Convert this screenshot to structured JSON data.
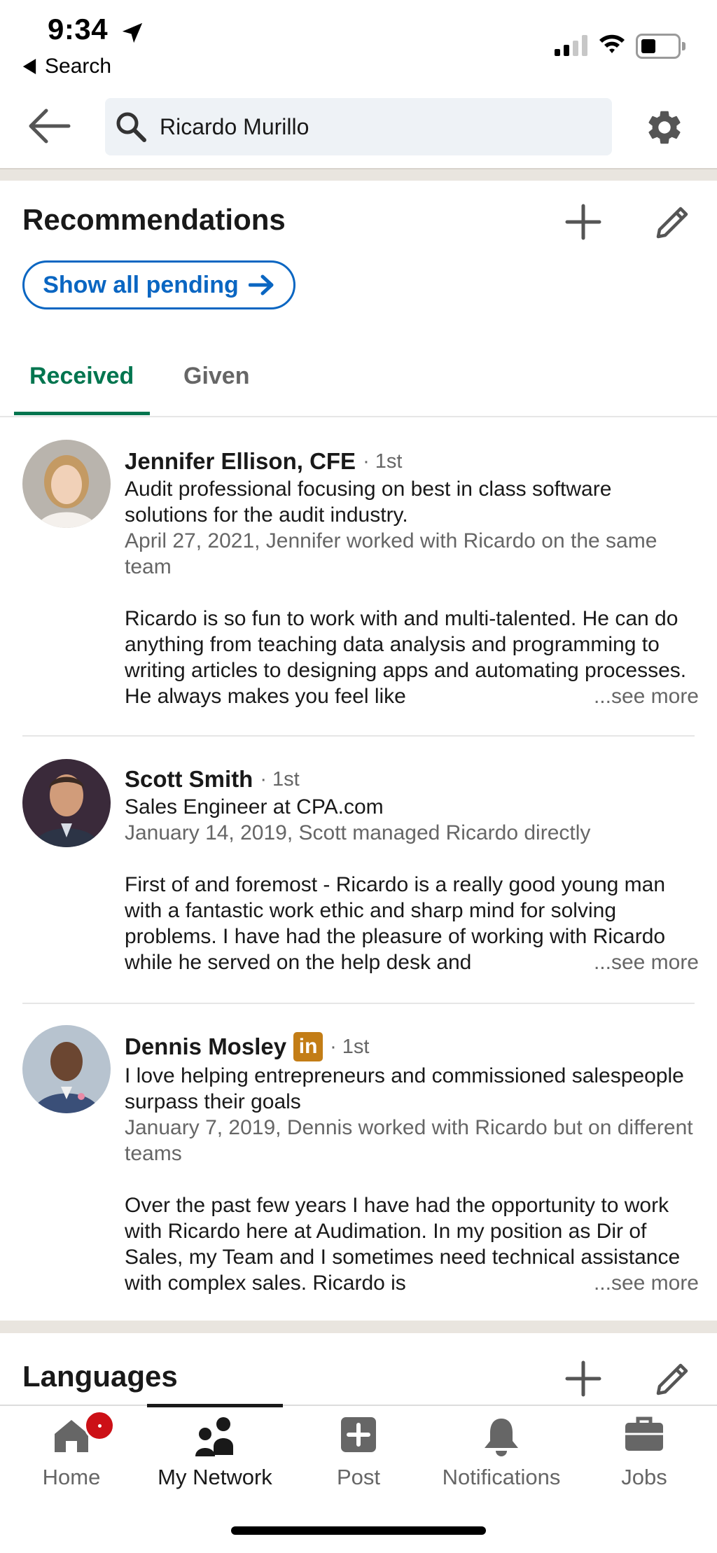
{
  "status_bar": {
    "time": "9:34",
    "back_app": "Search"
  },
  "search": {
    "value": "Ricardo Murillo",
    "placeholder": ""
  },
  "recommendations": {
    "title": "Recommendations",
    "pending_button": "Show all pending",
    "tabs": [
      {
        "label": "Received",
        "active": true
      },
      {
        "label": "Given",
        "active": false
      }
    ],
    "items": [
      {
        "name": "Jennifer Ellison, CFE",
        "degree": "· 1st",
        "headline": "Audit professional focusing on best in class software solutions for the audit industry.",
        "meta": "April 27, 2021, Jennifer worked with Ricardo on the same team",
        "body": "Ricardo is so fun to work with and multi-talented.   He can do anything from teaching data analysis and programming to writing articles to designing apps and automating processes.    He always makes you feel like",
        "see_more": "...see more"
      },
      {
        "name": "Scott Smith",
        "degree": "· 1st",
        "headline": "Sales Engineer at CPA.com",
        "meta": "January 14, 2019, Scott managed Ricardo directly",
        "body": "First of and foremost - Ricardo is a really good young man with a fantastic work ethic and sharp mind for solving problems.  I have had the pleasure of working with Ricardo while he served on the help desk and",
        "see_more": "...see more"
      },
      {
        "name": "Dennis Mosley",
        "badge": "in",
        "degree": "· 1st",
        "headline": "I love helping entrepreneurs and commissioned salespeople surpass their goals",
        "meta": "January 7, 2019, Dennis worked with Ricardo but on different teams",
        "body": "Over the past few years I have had the opportunity to work with Ricardo here at Audimation.  In my position as Dir of Sales, my Team and I sometimes need technical assistance with complex sales.  Ricardo is",
        "see_more": "...see more"
      }
    ]
  },
  "languages": {
    "title": "Languages"
  },
  "bottom_nav": [
    {
      "label": "Home",
      "icon": "home-icon",
      "active": false,
      "badge": "dot"
    },
    {
      "label": "My Network",
      "icon": "people-icon",
      "active": true
    },
    {
      "label": "Post",
      "icon": "plus-square-icon",
      "active": false
    },
    {
      "label": "Notifications",
      "icon": "bell-icon",
      "active": false
    },
    {
      "label": "Jobs",
      "icon": "briefcase-icon",
      "active": false
    }
  ],
  "colors": {
    "accent_blue": "#0a66c2",
    "active_green": "#01754f",
    "badge_red": "#cc1016",
    "linkedin_gold": "#c37d16"
  }
}
